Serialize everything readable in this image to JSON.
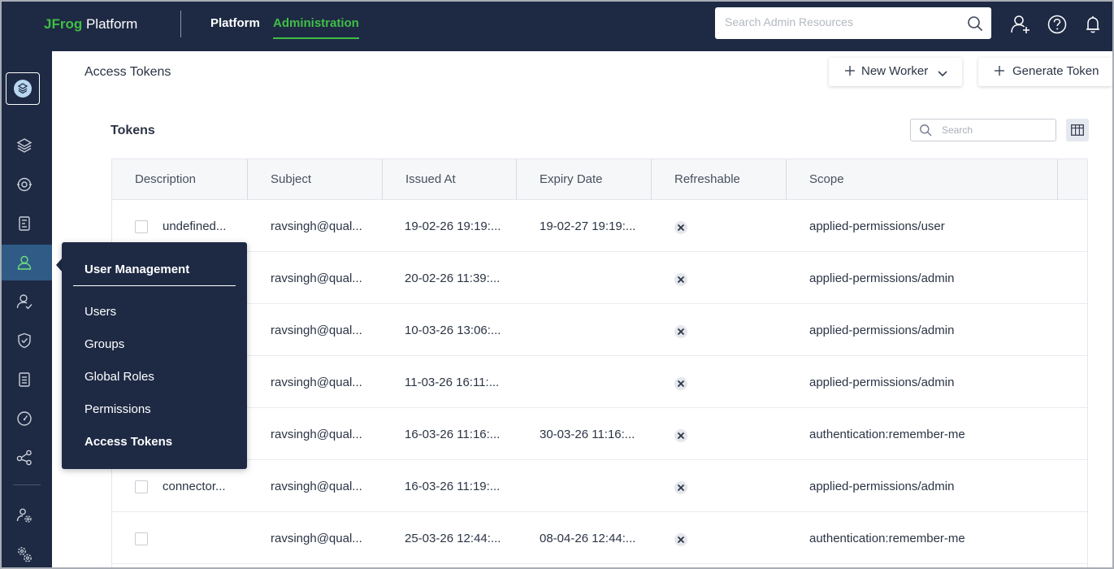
{
  "header": {
    "logo_brand": "JFrog",
    "logo_text": " Platform",
    "nav_platform": "Platform",
    "nav_administration": "Administration",
    "search_placeholder": "Search Admin Resources",
    "accent_color": "#40be46",
    "bg_color": "#1e2a44",
    "icons": [
      "add-user-icon",
      "help-icon",
      "bell-icon"
    ]
  },
  "sidebar": {
    "icons": [
      "platform-logo-icon",
      "layers-icon",
      "distribution-icon",
      "pipelines-icon",
      "user-management-icon",
      "user-check-icon",
      "shield-icon",
      "document-icon",
      "gauge-icon",
      "share-icon",
      "settings-gear-icon",
      "admin-gear-icon"
    ],
    "active": "user-management-icon"
  },
  "page": {
    "title": "Access Tokens",
    "new_worker_label": "New Worker",
    "generate_token_label": "Generate Token",
    "section_title": "Tokens",
    "search_placeholder": "Search"
  },
  "table": {
    "columns": [
      "Description",
      "Subject",
      "Issued At",
      "Expiry Date",
      "Refreshable",
      "Scope"
    ],
    "rows": [
      {
        "description": "undefined...",
        "subject": "ravsingh@qual...",
        "issued": "19-02-26 19:19:...",
        "expiry": "19-02-27 19:19:...",
        "refreshable": false,
        "scope": "applied-permissions/user"
      },
      {
        "description": "",
        "subject": "ravsingh@qual...",
        "issued": "20-02-26 11:39:...",
        "expiry": "",
        "refreshable": false,
        "scope": "applied-permissions/admin"
      },
      {
        "description": "",
        "subject": "ravsingh@qual...",
        "issued": "10-03-26 13:06:...",
        "expiry": "",
        "refreshable": false,
        "scope": "applied-permissions/admin"
      },
      {
        "description": "",
        "subject": "ravsingh@qual...",
        "issued": "11-03-26 16:11:...",
        "expiry": "",
        "refreshable": false,
        "scope": "applied-permissions/admin"
      },
      {
        "description": "",
        "subject": "ravsingh@qual...",
        "issued": "16-03-26 11:16:...",
        "expiry": "30-03-26 11:16:...",
        "refreshable": false,
        "scope": "authentication:remember-me"
      },
      {
        "description": "connector...",
        "subject": "ravsingh@qual...",
        "issued": "16-03-26 11:19:...",
        "expiry": "",
        "refreshable": false,
        "scope": "applied-permissions/admin"
      },
      {
        "description": "",
        "subject": "ravsingh@qual...",
        "issued": "25-03-26 12:44:...",
        "expiry": "08-04-26 12:44:...",
        "refreshable": false,
        "scope": "authentication:remember-me"
      }
    ]
  },
  "flyout": {
    "title": "User Management",
    "items": [
      "Users",
      "Groups",
      "Global Roles",
      "Permissions",
      "Access Tokens"
    ],
    "current": "Access Tokens"
  }
}
